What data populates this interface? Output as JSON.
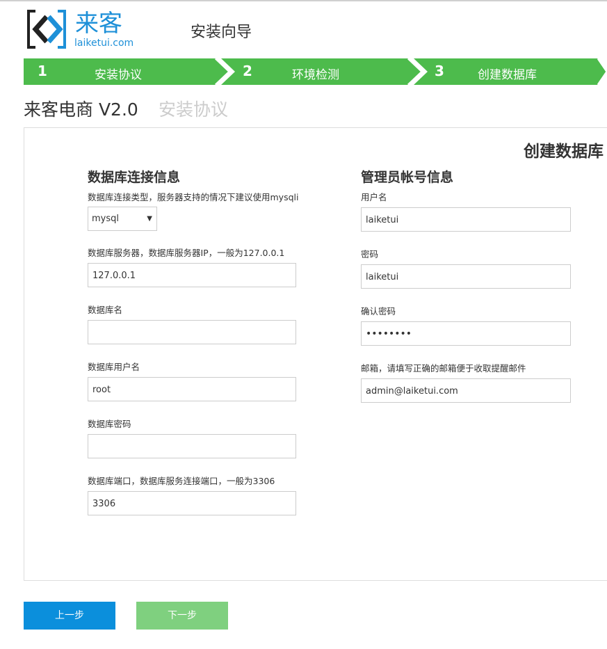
{
  "header": {
    "logo_cn": "来客",
    "logo_en": "laiketui.com",
    "wizard_title": "安装向导"
  },
  "steps": [
    {
      "number": "1",
      "label": "安装协议"
    },
    {
      "number": "2",
      "label": "环境检测"
    },
    {
      "number": "3",
      "label": "创建数据库"
    }
  ],
  "page": {
    "title": "来客电商 V2.0",
    "subtitle": "安装协议"
  },
  "panel": {
    "heading": "创建数据库"
  },
  "db_section": {
    "title": "数据库连接信息",
    "type_label": "数据库连接类型，服务器支持的情况下建议使用mysqli",
    "type_value": "mysql",
    "server_label": "数据库服务器，数据库服务器IP，一般为127.0.0.1",
    "server_value": "127.0.0.1",
    "name_label": "数据库名",
    "name_value": "",
    "user_label": "数据库用户名",
    "user_value": "root",
    "password_label": "数据库密码",
    "password_value": "",
    "port_label": "数据库端口，数据库服务连接端口，一般为3306",
    "port_value": "3306"
  },
  "admin_section": {
    "title": "管理员帐号信息",
    "username_label": "用户名",
    "username_value": "laiketui",
    "password_label": "密码",
    "password_value": "laiketui",
    "confirm_label": "确认密码",
    "confirm_value": "••••••••",
    "email_label": "邮箱，请填写正确的邮箱便于收取提醒邮件",
    "email_value": "admin@laiketui.com"
  },
  "buttons": {
    "prev": "上一步",
    "next": "下一步"
  },
  "colors": {
    "step_green": "#4dbb4c",
    "brand_blue": "#1e90d8",
    "prev_button": "#0b8fdc",
    "next_button": "#7fd07f"
  }
}
